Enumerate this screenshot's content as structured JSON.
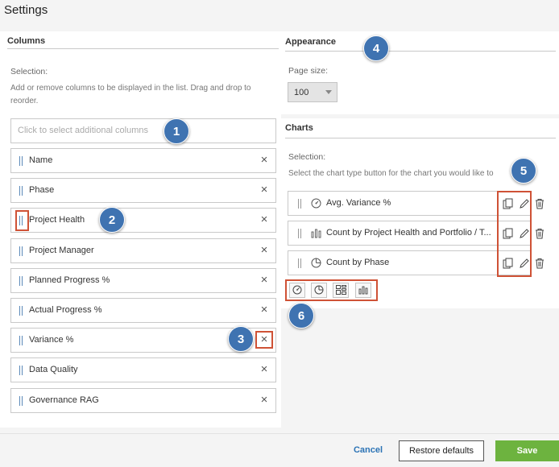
{
  "page": {
    "title": "Settings"
  },
  "columns": {
    "header": "Columns",
    "selection_label": "Selection:",
    "hint": "Add or remove columns to be displayed in the list. Drag and drop to reorder.",
    "search_placeholder": "Click to select additional columns",
    "items": [
      {
        "label": "Name"
      },
      {
        "label": "Phase"
      },
      {
        "label": "Project Health"
      },
      {
        "label": "Project Manager"
      },
      {
        "label": "Planned Progress %"
      },
      {
        "label": "Actual Progress %"
      },
      {
        "label": "Variance %"
      },
      {
        "label": "Data Quality"
      },
      {
        "label": "Governance RAG"
      }
    ]
  },
  "appearance": {
    "header": "Appearance",
    "page_size_label": "Page size:",
    "page_size_value": "100"
  },
  "charts": {
    "header": "Charts",
    "selection_label": "Selection:",
    "hint": "Select the chart type button for the chart you would like to",
    "items": [
      {
        "label": "Avg. Variance %",
        "icon": "gauge-icon"
      },
      {
        "label": "Count by Project Health and Portfolio / T...",
        "icon": "bar-chart-icon"
      },
      {
        "label": "Count by Phase",
        "icon": "pie-chart-icon"
      }
    ],
    "type_buttons": [
      "gauge-icon",
      "pie-chart-icon",
      "table-chart-icon",
      "bar-chart-icon"
    ]
  },
  "callouts": [
    "1",
    "2",
    "3",
    "4",
    "5",
    "6"
  ],
  "footer": {
    "cancel": "Cancel",
    "restore": "Restore defaults",
    "save": "Save"
  },
  "colors": {
    "accent": "#3f73b1",
    "highlight": "#cf5236",
    "save": "#6db33f",
    "link": "#2b73b5"
  }
}
